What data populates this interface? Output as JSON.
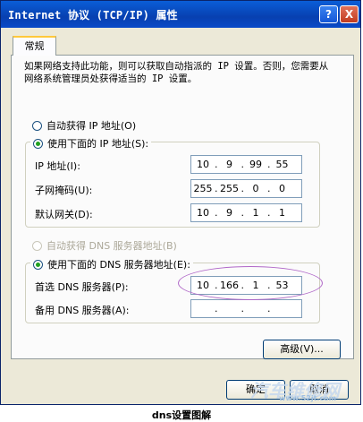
{
  "window": {
    "title": "Internet 协议 (TCP/IP) 属性",
    "help_label": "?",
    "close_label": "X"
  },
  "tabs": [
    {
      "label": "常规",
      "active": true
    }
  ],
  "intro": "如果网络支持此功能，则可以获取自动指派的 IP 设置。否则，您需要从网络系统管理员处获得适当的 IP 设置。",
  "ip_section": {
    "auto_option": {
      "label": "自动获得 IP 地址(O)",
      "selected": false
    },
    "manual_option": {
      "label": "使用下面的 IP 地址(S):",
      "selected": true
    },
    "fields": [
      {
        "label": "IP 地址(I):",
        "octets": [
          "10",
          "9",
          "99",
          "55"
        ]
      },
      {
        "label": "子网掩码(U):",
        "octets": [
          "255",
          "255",
          "0",
          "0"
        ]
      },
      {
        "label": "默认网关(D):",
        "octets": [
          "10",
          "9",
          "1",
          "1"
        ]
      }
    ]
  },
  "dns_section": {
    "auto_option": {
      "label": "自动获得 DNS 服务器地址(B)",
      "selected": false,
      "enabled": false
    },
    "manual_option": {
      "label": "使用下面的 DNS 服务器地址(E):",
      "selected": true
    },
    "fields": [
      {
        "label": "首选 DNS 服务器(P):",
        "octets": [
          "10",
          "166",
          "1",
          "53"
        ]
      },
      {
        "label": "备用 DNS 服务器(A):",
        "octets": [
          "",
          "",
          "",
          ""
        ]
      }
    ]
  },
  "buttons": {
    "advanced": "高级(V)...",
    "ok": "确定",
    "cancel": "取消"
  },
  "watermark": {
    "text": "汽车维修网",
    "sub": "www.52jt.com"
  },
  "caption": "dns设置图解",
  "colors": {
    "title_bar": "#0a4ac8",
    "highlight_ellipse": "#b068c8",
    "radio_dot": "#21a121"
  }
}
